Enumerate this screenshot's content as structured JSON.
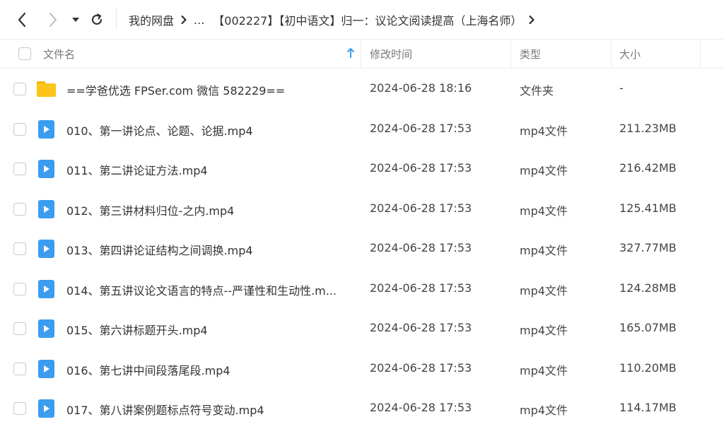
{
  "toolbar": {
    "back_icon": "chevron-left-icon",
    "forward_icon": "chevron-right-icon",
    "dropdown_icon": "caret-down-icon",
    "refresh_icon": "refresh-icon",
    "breadcrumb": {
      "root": "我的网盘",
      "ellipsis": "...",
      "current": "【002227】【初中语文】归一：议论文阅读提高（上海名师）"
    }
  },
  "columns": {
    "name": "文件名",
    "modified": "修改时间",
    "type": "类型",
    "size": "大小"
  },
  "colors": {
    "folder": "#fcc419",
    "video": "#3b9cf0",
    "sort_arrow": "#3b9cf0"
  },
  "files": [
    {
      "name": "==学爸优选 FPSer.com 微信 582229==",
      "modified": "2024-06-28 18:16",
      "type": "文件夹",
      "size": "-",
      "icon": "folder-icon"
    },
    {
      "name": "010、第一讲论点、论题、论据.mp4",
      "modified": "2024-06-28 17:53",
      "type": "mp4文件",
      "size": "211.23MB",
      "icon": "video-icon"
    },
    {
      "name": "011、第二讲论证方法.mp4",
      "modified": "2024-06-28 17:53",
      "type": "mp4文件",
      "size": "216.42MB",
      "icon": "video-icon"
    },
    {
      "name": "012、第三讲材料归位-之内.mp4",
      "modified": "2024-06-28 17:53",
      "type": "mp4文件",
      "size": "125.41MB",
      "icon": "video-icon"
    },
    {
      "name": "013、第四讲论证结构之间调换.mp4",
      "modified": "2024-06-28 17:53",
      "type": "mp4文件",
      "size": "327.77MB",
      "icon": "video-icon"
    },
    {
      "name": "014、第五讲议论文语言的特点--严谨性和生动性.m...",
      "modified": "2024-06-28 17:53",
      "type": "mp4文件",
      "size": "124.28MB",
      "icon": "video-icon"
    },
    {
      "name": "015、第六讲标题开头.mp4",
      "modified": "2024-06-28 17:53",
      "type": "mp4文件",
      "size": "165.07MB",
      "icon": "video-icon"
    },
    {
      "name": "016、第七讲中间段落尾段.mp4",
      "modified": "2024-06-28 17:53",
      "type": "mp4文件",
      "size": "110.20MB",
      "icon": "video-icon"
    },
    {
      "name": "017、第八讲案例题标点符号变动.mp4",
      "modified": "2024-06-28 17:53",
      "type": "mp4文件",
      "size": "114.17MB",
      "icon": "video-icon"
    }
  ]
}
